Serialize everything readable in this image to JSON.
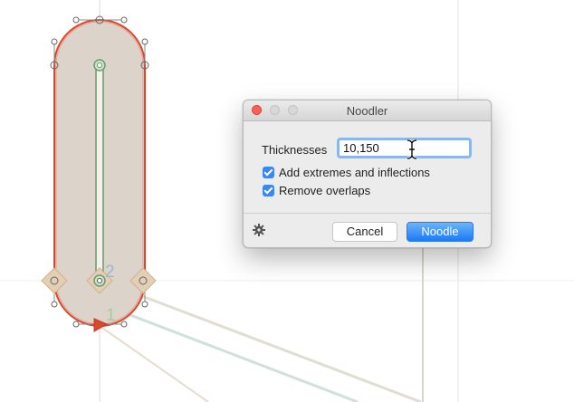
{
  "canvas": {
    "node_label_top": "2",
    "node_label_bottom": "1"
  },
  "dialog": {
    "title": "Noodler",
    "thicknesses_label": "Thicknesses",
    "thicknesses_value": "10,150",
    "add_extremes_label": "Add extremes and inflections",
    "add_extremes_checked": true,
    "remove_overlaps_label": "Remove overlaps",
    "remove_overlaps_checked": true,
    "cancel_label": "Cancel",
    "noodle_label": "Noodle",
    "accent_color": "#1b7bf6"
  }
}
